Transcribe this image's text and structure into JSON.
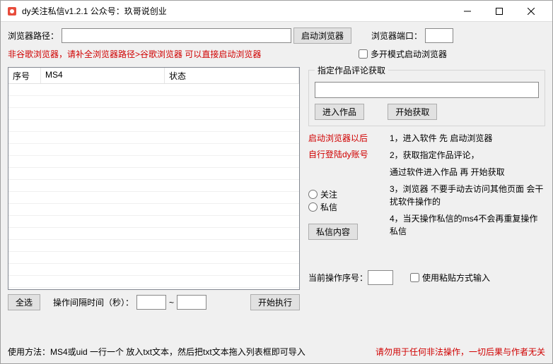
{
  "window": {
    "title": "dy关注私信v1.2.1  公众号：玖哥说创业"
  },
  "browser": {
    "path_label": "浏览器路径：",
    "path_value": "",
    "start_btn": "启动浏览器",
    "port_label": "浏览器端口：",
    "port_value": "",
    "hint": "非谷歌浏览器，请补全浏览器路径>谷歌浏览器 可以直接启动浏览器",
    "multi_open": "多开模式启动浏览器"
  },
  "table": {
    "col1": "序号",
    "col2": "MS4",
    "col3": "状态"
  },
  "comment_box": {
    "legend": "指定作品评论获取",
    "input_value": "",
    "enter_btn": "进入作品",
    "start_btn": "开始获取"
  },
  "mid": {
    "note1": "启动浏览器以后",
    "note2": "自行登陆dy账号",
    "radio_follow": "关注",
    "radio_dm": "私信",
    "dm_btn": "私信内容"
  },
  "steps": {
    "s1": "1，进入软件 先 启动浏览器",
    "s2": "2，获取指定作品评论，",
    "s2b": "通过软件进入作品 再 开始获取",
    "s3": "3，浏览器 不要手动去访问其他页面 会干扰软件操作的",
    "s4": "4，当天操作私信的ms4不会再重复操作私信"
  },
  "current": {
    "label": "当前操作序号：",
    "value": "",
    "paste_check": "使用粘贴方式输入"
  },
  "bottom": {
    "select_all": "全选",
    "interval_label": "操作间隔时间（秒）：",
    "min": "",
    "dash": "~",
    "max": "",
    "exec_btn": "开始执行"
  },
  "footer": {
    "usage": "使用方法：MS4或uid 一行一个 放入txt文本，然后把txt文本拖入列表框即可导入",
    "warn": "请勿用于任何非法操作，一切后果与作者无关"
  }
}
